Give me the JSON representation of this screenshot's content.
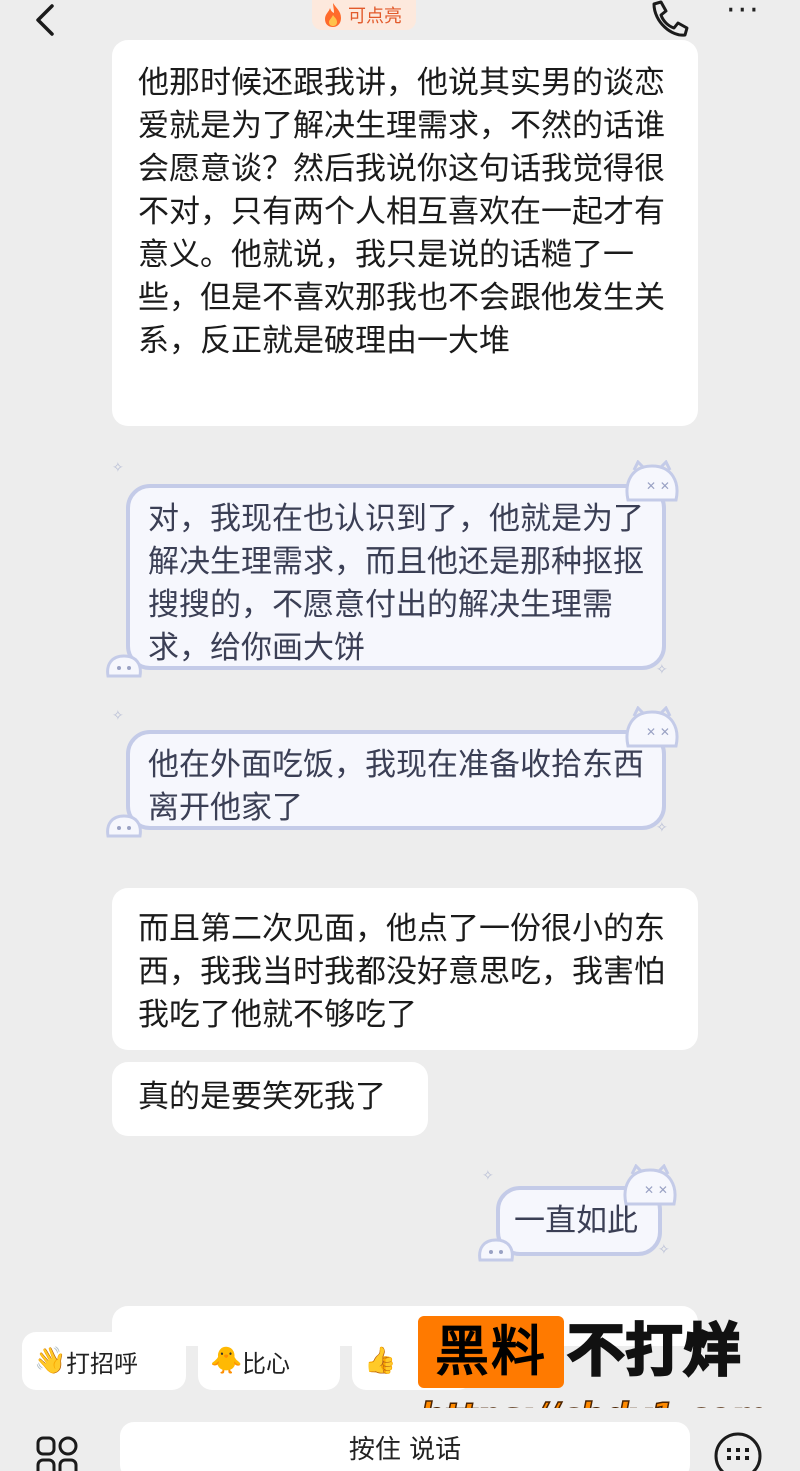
{
  "header": {
    "back_icon": "chevron-left-icon",
    "badge_icon": "flame-icon",
    "badge_label": "可点亮",
    "call_icon": "phone-icon",
    "more_label": "···"
  },
  "messages": [
    {
      "side": "incoming",
      "text": "他那时候还跟我讲，他说其实男的谈恋爱就是为了解决生理需求，不然的话谁会愿意谈？然后我说你这句话我觉得很不对，只有两个人相互喜欢在一起才有意义。他就说，我只是说的话糙了一些，但是不喜欢那我也不会跟他发生关系，反正就是破理由一大堆"
    },
    {
      "side": "outgoing",
      "text": "对，我现在也认识到了，他就是为了解决生理需求，而且他还是那种抠抠搜搜的，不愿意付出的解决生理需求，给你画大饼"
    },
    {
      "side": "outgoing",
      "text": "他在外面吃饭，我现在准备收拾东西离开他家了"
    },
    {
      "side": "incoming",
      "text": "而且第二次见面，他点了一份很小的东西，我我当时我都没好意思吃，我害怕我吃了他就不够吃了"
    },
    {
      "side": "incoming",
      "text": "真的是要笑死我了"
    },
    {
      "side": "outgoing",
      "text": "一直如此"
    }
  ],
  "quick_replies": [
    {
      "label": "打招呼",
      "icon": "wave-hand-icon"
    },
    {
      "label": "比心",
      "icon": "heart-hand-duck-icon"
    },
    {
      "label": "",
      "icon": "thumbs-up-icon"
    }
  ],
  "input": {
    "apps_icon": "apps-grid-icon",
    "voice_label": "按住 说话",
    "keyboard_icon": "keyboard-icon"
  },
  "watermark": {
    "box_text": "黑料",
    "text": "不打烊",
    "url": "https://cbdy1.com"
  },
  "colors": {
    "background": "#ededed",
    "bubble_incoming": "#ffffff",
    "bubble_outgoing_fill": "#f6f7fd",
    "bubble_outgoing_border": "#c4cbe8",
    "badge_text": "#e25a2b",
    "watermark_orange": "#ff7a00"
  }
}
